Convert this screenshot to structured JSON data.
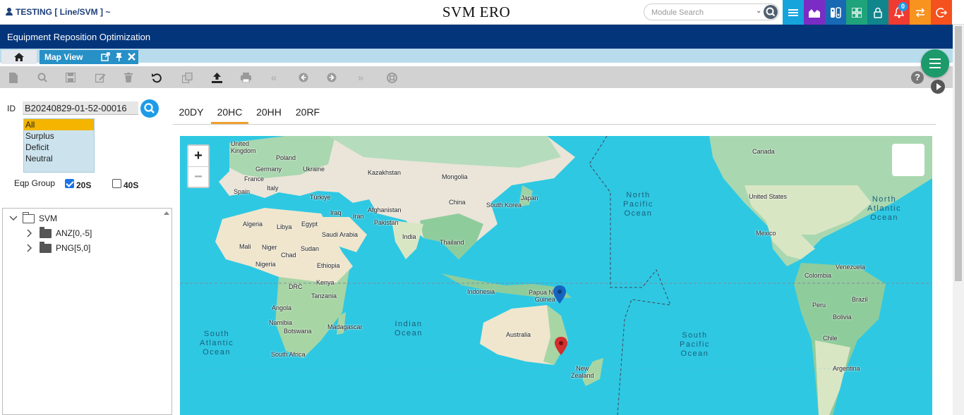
{
  "header": {
    "user_label": "TESTING [ Line/SVM ] ~",
    "app_title": "SVM ERO",
    "search_placeholder": "Module Search",
    "notification_count": "0",
    "icon_colors": [
      "#16a4dc",
      "#7b2cc4",
      "#1769b4",
      "#1fa37a",
      "#10858c",
      "#ef3b31",
      "#f7931e",
      "#f4511e"
    ]
  },
  "nav": {
    "title": "Equipment Reposition Optimization"
  },
  "tabs": {
    "map_view_label": "Map View"
  },
  "filter": {
    "id_label": "ID",
    "id_value": "B20240829-01-52-00016",
    "status_options": [
      "All",
      "Surplus",
      "Deficit",
      "Neutral"
    ],
    "status_selected": "All",
    "eqp_group_label": "Eqp Group",
    "eqp_groups": [
      {
        "label": "20S",
        "checked": true
      },
      {
        "label": "40S",
        "checked": false
      }
    ]
  },
  "tree": {
    "root": "SVM",
    "children": [
      "ANZ[0,-5]",
      "PNG[5,0]"
    ]
  },
  "subtabs": [
    "20DY",
    "20HC",
    "20HH",
    "20RF"
  ],
  "active_subtab": "20HC",
  "map": {
    "zoom_in": "+",
    "zoom_out": "−",
    "oceans": {
      "north_pacific": "North\nPacific\nOcean",
      "north_atlantic": "North\nAtlantic\nOcean",
      "south_pacific": "South\nPacific\nOcean",
      "south_atlantic": "South\nAtlantic\nOcean",
      "indian": "Indian\nOcean"
    },
    "labels": {
      "united_kingdom": "United\nKingdom",
      "poland": "Poland",
      "germany": "Germany",
      "ukraine": "Ukraine",
      "france": "France",
      "italy": "Italy",
      "spain": "Spain",
      "turkiye": "Türkiye",
      "kazakhstan": "Kazakhstan",
      "mongolia": "Mongolia",
      "china": "China",
      "south_korea": "South Korea",
      "japan": "Japan",
      "iraq": "Iraq",
      "iran": "Iran",
      "afghanistan": "Afghanistan",
      "pakistan": "Pakistan",
      "india": "India",
      "thailand": "Thailand",
      "saudi_arabia": "Saudi Arabia",
      "egypt": "Egypt",
      "algeria": "Algeria",
      "libya": "Libya",
      "mali": "Mali",
      "niger": "Niger",
      "chad": "Chad",
      "sudan": "Sudan",
      "nigeria": "Nigeria",
      "ethiopia": "Ethiopia",
      "kenya": "Kenya",
      "drc": "DRC",
      "tanzania": "Tanzania",
      "angola": "Angola",
      "namibia": "Namibia",
      "botswana": "Botswana",
      "madagascar": "Madagascar",
      "south_africa": "South Africa",
      "indonesia": "Indonesia",
      "png": "Papua New\nGuinea",
      "australia": "Australia",
      "new_zealand": "New\nZealand",
      "canada": "Canada",
      "united_states": "United States",
      "mexico": "Mexico",
      "venezuela": "Venezuela",
      "colombia": "Colombia",
      "peru": "Peru",
      "brazil": "Brazil",
      "bolivia": "Bolivia",
      "chile": "Chile",
      "argentina": "Argentina"
    },
    "markers": [
      {
        "name": "PNG",
        "color": "#1565c0"
      },
      {
        "name": "ANZ",
        "color": "#d32f2f"
      }
    ]
  }
}
